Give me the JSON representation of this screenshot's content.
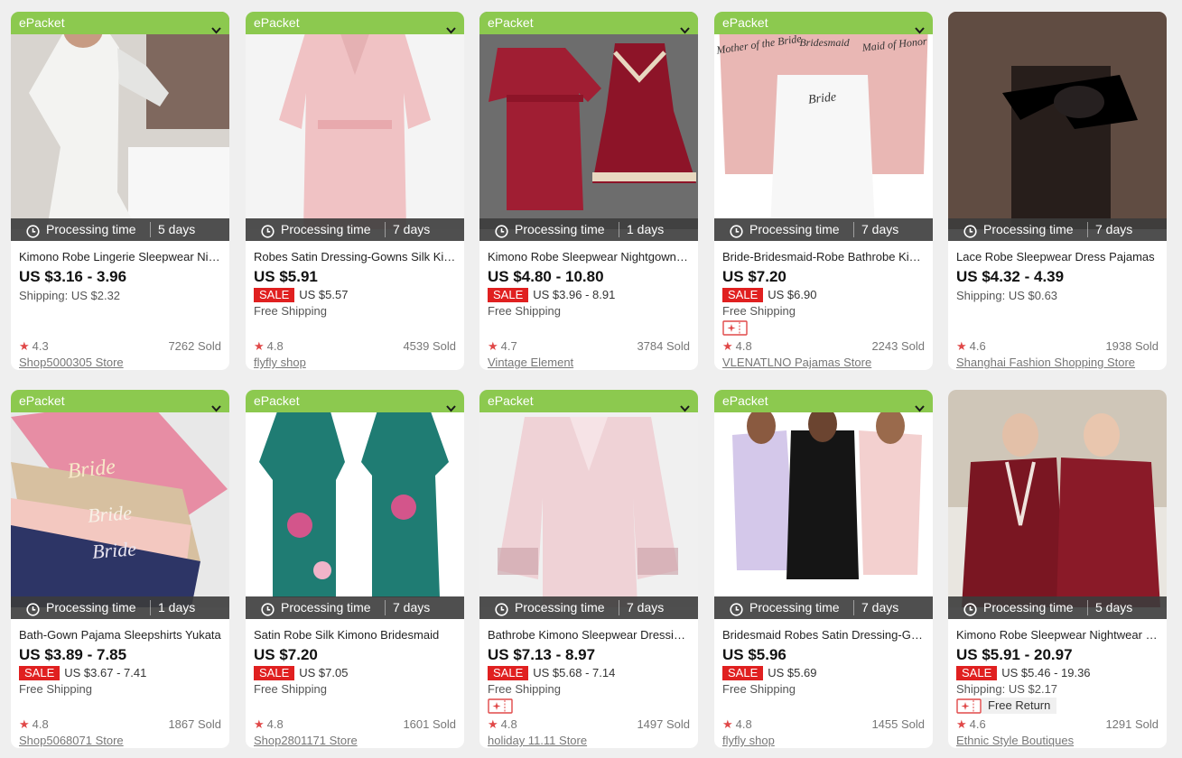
{
  "products": [
    {
      "tag": "ePacket",
      "processing_label": "Processing time",
      "processing_days": "5 days",
      "title": "Kimono Robe Lingerie Sleepwear Nightgown",
      "price": "US $3.16 - 3.96",
      "sale_badge": "",
      "sale_price": "",
      "shipping": "Shipping: US $2.32",
      "coupon": false,
      "free_return": "",
      "rating": "4.3",
      "sold": "7262 Sold",
      "store": "Shop5000305 Store",
      "image": "white-satin-lace-robe",
      "colors": {
        "bg": "#d8d4cf",
        "garment": "#f3f3f1",
        "accent": "#5a3a2e"
      }
    },
    {
      "tag": "ePacket",
      "processing_label": "Processing time",
      "processing_days": "7 days",
      "title": "Robes Satin Dressing-Gowns Silk Kimono",
      "price": "US $5.91",
      "sale_badge": "SALE",
      "sale_price": "US $5.57",
      "shipping": "Free Shipping",
      "coupon": false,
      "free_return": "",
      "rating": "4.8",
      "sold": "4539 Sold",
      "store": "flyfly shop",
      "image": "pink-satin-robe",
      "colors": {
        "bg": "#f4f4f4",
        "garment": "#f0c2c4",
        "accent": "#3a2a22"
      }
    },
    {
      "tag": "ePacket",
      "processing_label": "Processing time",
      "processing_days": "1 days",
      "title": "Kimono Robe Sleepwear Nightgown Set",
      "price": "US $4.80 - 10.80",
      "sale_badge": "SALE",
      "sale_price": "US $3.96 - 8.91",
      "shipping": "Free Shipping",
      "coupon": false,
      "free_return": "",
      "rating": "4.7",
      "sold": "3784 Sold",
      "store": "Vintage Element",
      "image": "burgundy-robe-and-slip",
      "colors": {
        "bg": "#6d6d6d",
        "garment": "#a01e33",
        "accent": "#e8d8c0"
      }
    },
    {
      "tag": "ePacket",
      "processing_label": "Processing time",
      "processing_days": "7 days",
      "title": "Bride-Bridesmaid-Robe Bathrobe Kimono",
      "price": "US $7.20",
      "sale_badge": "SALE",
      "sale_price": "US $6.90",
      "shipping": "Free Shipping",
      "coupon": true,
      "free_return": "",
      "rating": "4.8",
      "sold": "2243 Sold",
      "store": "VLENATLNO Pajamas Store",
      "image": "bridal-party-robes",
      "colors": {
        "bg": "#ffffff",
        "garment": "#e9b7b4",
        "accent": "#f7f7f7"
      },
      "image_text": [
        "Mother of the Bride",
        "Bridesmaid",
        "Maid of Honor",
        "Bride"
      ]
    },
    {
      "tag": "",
      "processing_label": "Processing time",
      "processing_days": "7 days",
      "title": "Lace Robe Sleepwear Dress Pajamas",
      "price": "US $4.32 - 4.39",
      "sale_badge": "",
      "sale_price": "",
      "shipping": "Shipping: US $0.63",
      "coupon": false,
      "free_return": "",
      "rating": "4.6",
      "sold": "1938 Sold",
      "store": "Shanghai Fashion Shopping Store",
      "image": "black-sheer-lace-robe",
      "colors": {
        "bg": "#c9a894",
        "garment": "#1b1616",
        "accent": "#000000"
      }
    },
    {
      "tag": "ePacket",
      "processing_label": "Processing time",
      "processing_days": "1 days",
      "title": "Bath-Gown Pajama Sleepshirts Yukata",
      "price": "US $3.89 - 7.85",
      "sale_badge": "SALE",
      "sale_price": "US $3.67 - 7.41",
      "shipping": "Free Shipping",
      "coupon": false,
      "free_return": "",
      "rating": "4.8",
      "sold": "1867 Sold",
      "store": "Shop5068071 Store",
      "image": "stack-of-bride-robes",
      "colors": {
        "bg": "#e8e8e8",
        "garment": "#e78da4",
        "accent": "#2d3566"
      },
      "image_text": [
        "Bride",
        "Bride",
        "Bride"
      ]
    },
    {
      "tag": "ePacket",
      "processing_label": "Processing time",
      "processing_days": "7 days",
      "title": "Satin Robe Silk Kimono Bridesmaid",
      "price": "US $7.20",
      "sale_badge": "SALE",
      "sale_price": "US $7.05",
      "shipping": "Free Shipping",
      "coupon": false,
      "free_return": "",
      "rating": "4.8",
      "sold": "1601 Sold",
      "store": "Shop2801171 Store",
      "image": "teal-peacock-kimono",
      "colors": {
        "bg": "#ffffff",
        "garment": "#1f7c73",
        "accent": "#d3558b"
      }
    },
    {
      "tag": "ePacket",
      "processing_label": "Processing time",
      "processing_days": "7 days",
      "title": "Bathrobe Kimono Sleepwear Dressing Gown",
      "price": "US $7.13 - 8.97",
      "sale_badge": "SALE",
      "sale_price": "US $5.68 - 7.14",
      "shipping": "Free Shipping",
      "coupon": true,
      "free_return": "",
      "rating": "4.8",
      "sold": "1497 Sold",
      "store": "holiday 11.11 Store",
      "image": "pale-pink-lace-robe",
      "colors": {
        "bg": "#a9a5a2",
        "garment": "#efd2d6",
        "accent": "#c89ea5"
      }
    },
    {
      "tag": "ePacket",
      "processing_label": "Processing time",
      "processing_days": "7 days",
      "title": "Bridesmaid Robes Satin Dressing-Gown",
      "price": "US $5.96",
      "sale_badge": "SALE",
      "sale_price": "US $5.69",
      "shipping": "Free Shipping",
      "coupon": false,
      "free_return": "",
      "rating": "4.8",
      "sold": "1455 Sold",
      "store": "flyfly shop",
      "image": "three-satin-robes",
      "colors": {
        "bg": "#ffffff",
        "garment": "#d4c8ea",
        "accent": "#151515"
      }
    },
    {
      "tag": "",
      "processing_label": "Processing time",
      "processing_days": "5 days",
      "title": "Kimono Robe Sleepwear Nightwear Couple",
      "price": "US $5.91 - 20.97",
      "sale_badge": "SALE",
      "sale_price": "US $5.46 - 19.36",
      "shipping": "Shipping: US $2.17",
      "coupon": true,
      "free_return": "Free Return",
      "rating": "4.6",
      "sold": "1291 Sold",
      "store": "Ethnic Style Boutiques",
      "image": "couple-velvet-robes",
      "colors": {
        "bg": "#cfc6b8",
        "garment": "#7a1622",
        "accent": "#efe3dd"
      }
    }
  ],
  "icons": {
    "epacket_toggle": "chevron-down-icon",
    "processing": "clock-icon",
    "rating": "star-icon",
    "coupon": "coupon-icon"
  },
  "theme": {
    "page_bg": "#efefef",
    "epacket_green": "#8cc94f",
    "processing_bar": "#3c3c3c",
    "sale_red": "#e02020",
    "star_red": "#e04848"
  }
}
